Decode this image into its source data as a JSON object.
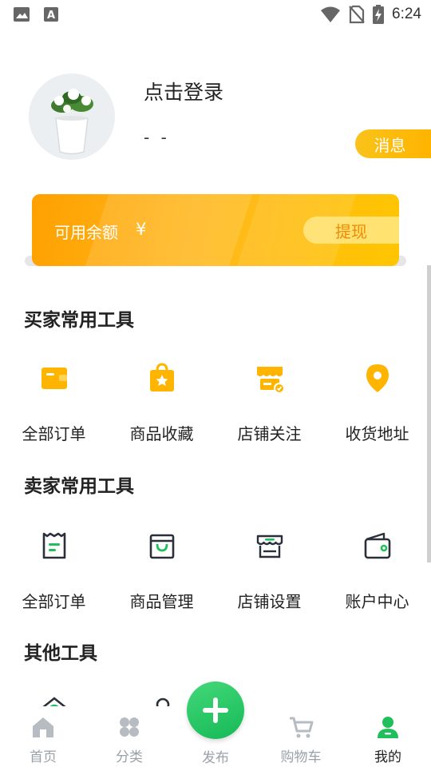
{
  "status_bar": {
    "time": "6:24"
  },
  "profile": {
    "login_text": "点击登录",
    "subtext": "- -",
    "message_button": "消息"
  },
  "balance": {
    "label": "可用余额",
    "currency": "¥",
    "withdraw_button": "提现"
  },
  "buyer_tools": {
    "title": "买家常用工具",
    "items": [
      {
        "label": "全部订单",
        "icon": "wallet-icon"
      },
      {
        "label": "商品收藏",
        "icon": "star-bag-icon"
      },
      {
        "label": "店铺关注",
        "icon": "store-follow-icon"
      },
      {
        "label": "收货地址",
        "icon": "location-pin-icon"
      }
    ]
  },
  "seller_tools": {
    "title": "卖家常用工具",
    "items": [
      {
        "label": "全部订单",
        "icon": "receipt-icon"
      },
      {
        "label": "商品管理",
        "icon": "shopping-bag-icon"
      },
      {
        "label": "店铺设置",
        "icon": "store-icon"
      },
      {
        "label": "账户中心",
        "icon": "wallet-outline-icon"
      }
    ]
  },
  "other_tools": {
    "title": "其他工具"
  },
  "bottom_nav": {
    "items": [
      {
        "label": "首页",
        "icon": "home-icon",
        "active": false
      },
      {
        "label": "分类",
        "icon": "category-icon",
        "active": false
      },
      {
        "label": "发布",
        "icon": "plus-icon",
        "active": false
      },
      {
        "label": "购物车",
        "icon": "cart-icon",
        "active": false
      },
      {
        "label": "我的",
        "icon": "user-icon",
        "active": true
      }
    ]
  },
  "colors": {
    "accent_orange": "#ffb400",
    "accent_green": "#1fbf5c",
    "inactive_gray": "#9aa1a8"
  }
}
